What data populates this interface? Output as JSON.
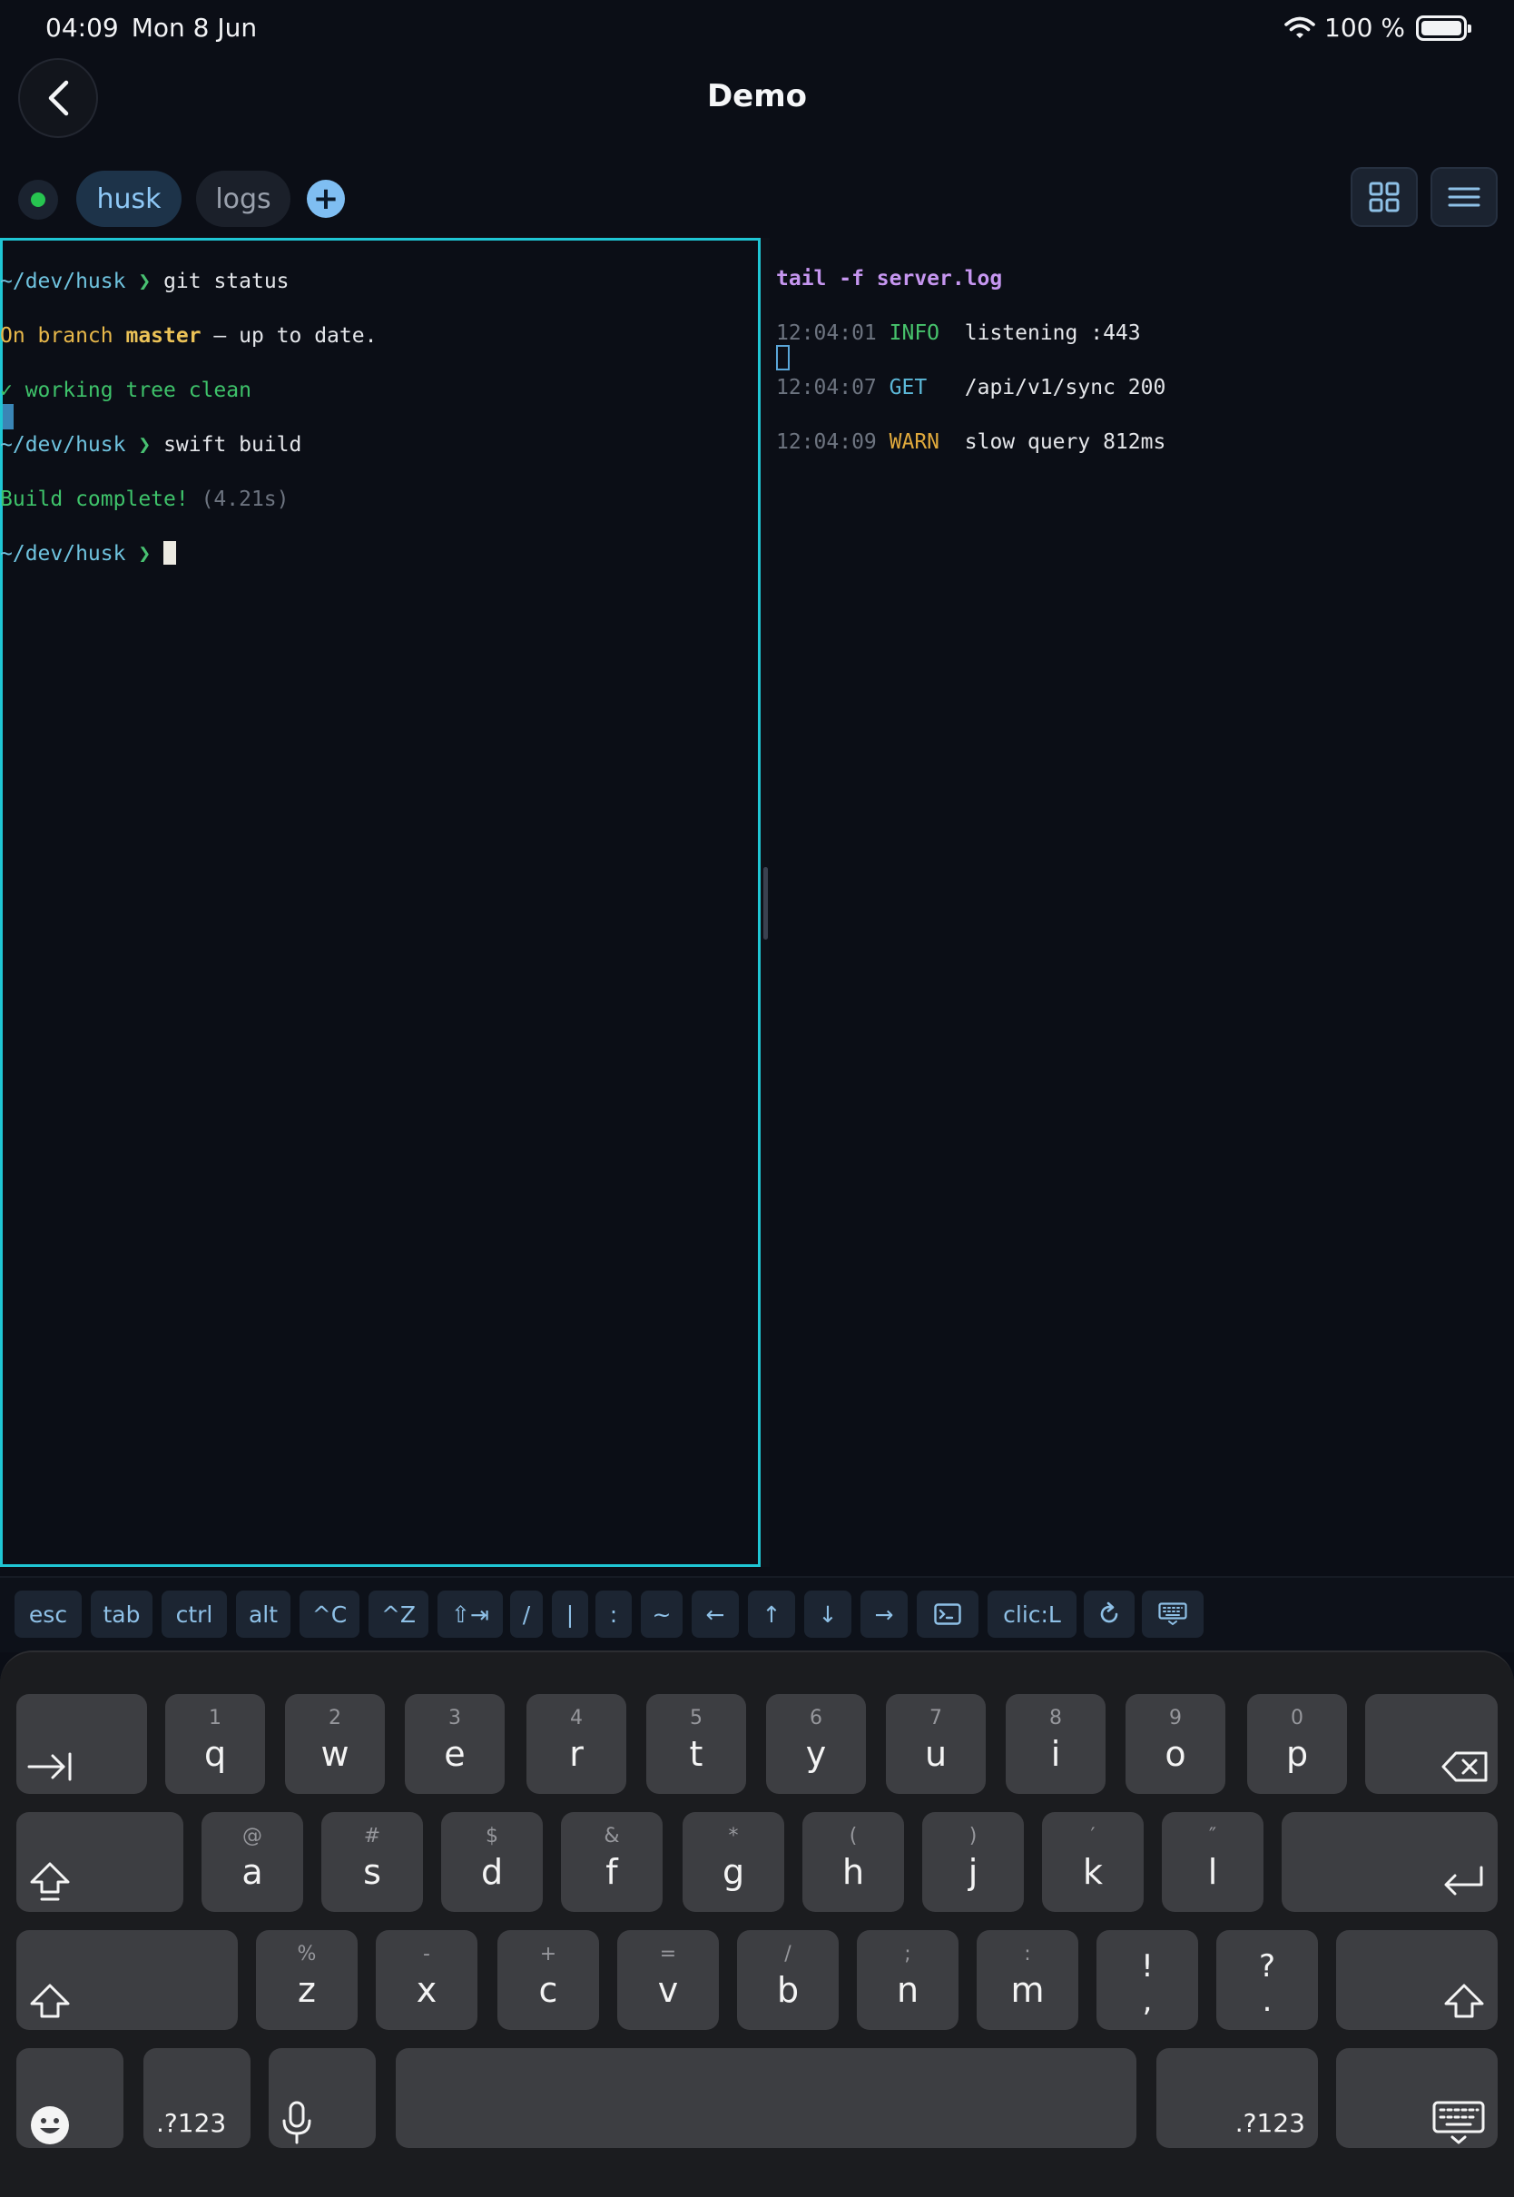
{
  "status_bar": {
    "time": "04:09",
    "date": "Mon 8 Jun",
    "battery": "100 %"
  },
  "nav": {
    "title": "Demo"
  },
  "tabs": [
    {
      "label": "husk",
      "active": true
    },
    {
      "label": "logs",
      "active": false
    }
  ],
  "add_tab_glyph": "+",
  "panes": {
    "left": {
      "lines": [
        {
          "prompt": "~/dev/husk",
          "arrow": "❯",
          "cmd": "git status"
        },
        {
          "p1": "On branch ",
          "branch": "master",
          "p2": " — up to date."
        },
        {
          "text": "✓ working tree clean"
        },
        {
          "prompt": "~/dev/husk",
          "arrow": "❯",
          "cmd": "swift build"
        },
        {
          "ok": "Build complete!",
          "time": " (4.21s)"
        },
        {
          "prompt": "~/dev/husk",
          "arrow": "❯"
        }
      ]
    },
    "right": {
      "header": "tail -f server.log",
      "log": [
        {
          "time": "12:04:01",
          "level": "INFO ",
          "msg": "listening :443"
        },
        {
          "time": "12:04:07",
          "level": "GET  ",
          "msg": "/api/v1/sync 200"
        },
        {
          "time": "12:04:09",
          "level": "WARN ",
          "msg": "slow query 812ms"
        }
      ]
    }
  },
  "accessory_keys": [
    "esc",
    "tab",
    "ctrl",
    "alt",
    "^C",
    "^Z",
    "⇧⇥",
    "/",
    "|",
    ":",
    "~",
    "←",
    "↑",
    "↓",
    "→",
    "terminal-icon",
    "clic:L",
    "refresh-icon",
    "keyboard-icon"
  ],
  "keyboard": {
    "row1": [
      {
        "hint": "1",
        "key": "q"
      },
      {
        "hint": "2",
        "key": "w"
      },
      {
        "hint": "3",
        "key": "e"
      },
      {
        "hint": "4",
        "key": "r"
      },
      {
        "hint": "5",
        "key": "t"
      },
      {
        "hint": "6",
        "key": "y"
      },
      {
        "hint": "7",
        "key": "u"
      },
      {
        "hint": "8",
        "key": "i"
      },
      {
        "hint": "9",
        "key": "o"
      },
      {
        "hint": "0",
        "key": "p"
      }
    ],
    "row2": [
      {
        "hint": "@",
        "key": "a"
      },
      {
        "hint": "#",
        "key": "s"
      },
      {
        "hint": "$",
        "key": "d"
      },
      {
        "hint": "&",
        "key": "f"
      },
      {
        "hint": "*",
        "key": "g"
      },
      {
        "hint": "(",
        "key": "h"
      },
      {
        "hint": ")",
        "key": "j"
      },
      {
        "hint": "′",
        "key": "k"
      },
      {
        "hint": "″",
        "key": "l"
      }
    ],
    "row3": [
      {
        "hint": "%",
        "key": "z"
      },
      {
        "hint": "-",
        "key": "x"
      },
      {
        "hint": "+",
        "key": "c"
      },
      {
        "hint": "=",
        "key": "v"
      },
      {
        "hint": "/",
        "key": "b"
      },
      {
        "hint": ";",
        "key": "n"
      },
      {
        "hint": ":",
        "key": "m"
      }
    ],
    "row3_punct": [
      {
        "top": "!",
        "bottom": ","
      },
      {
        "top": "?",
        "bottom": "."
      }
    ],
    "numbers_label": ".?123"
  }
}
